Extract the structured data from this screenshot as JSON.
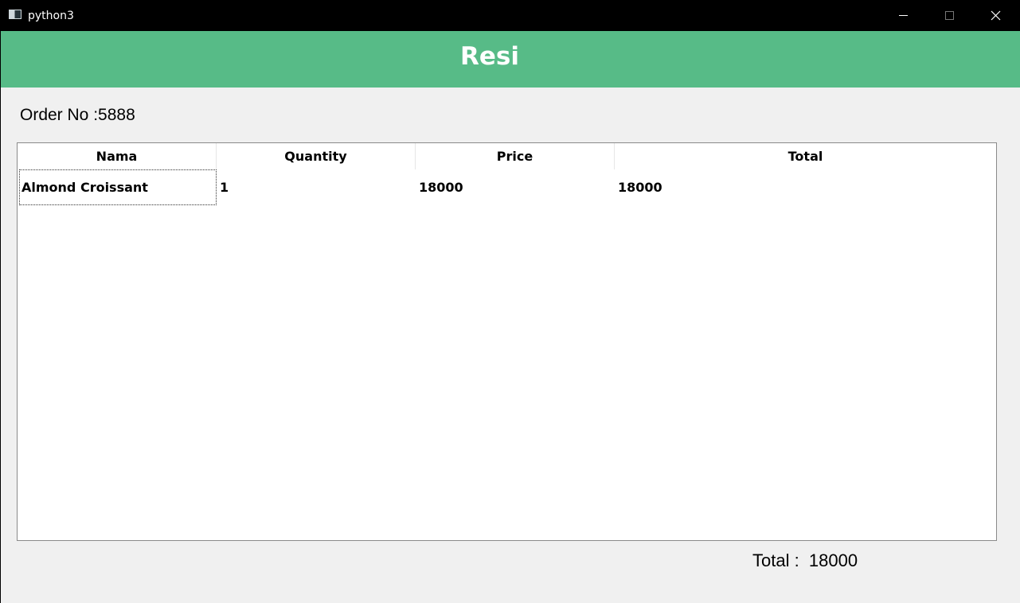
{
  "window": {
    "title": "python3",
    "app_icon": "python-window-icon",
    "controls": [
      "minimize-icon",
      "maximize-icon",
      "close-icon"
    ]
  },
  "header": {
    "title": "Resi",
    "background": "#57bb87"
  },
  "order": {
    "label": "Order No :5888"
  },
  "table": {
    "columns": [
      "Nama",
      "Quantity",
      "Price",
      "Total"
    ],
    "rows": [
      [
        "Almond Croissant",
        "1",
        "18000",
        "18000"
      ]
    ]
  },
  "footer": {
    "total_text": "Total :  18000"
  }
}
